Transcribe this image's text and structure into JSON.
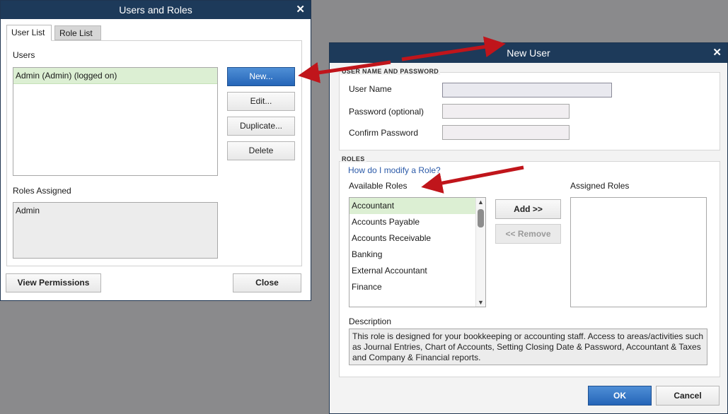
{
  "users_roles": {
    "title": "Users and Roles",
    "tabs": [
      {
        "label": "User List",
        "active": true
      },
      {
        "label": "Role List",
        "active": false
      }
    ],
    "users_label": "Users",
    "users": [
      "Admin (Admin) (logged on)"
    ],
    "buttons": {
      "new": "New...",
      "edit": "Edit...",
      "duplicate": "Duplicate...",
      "delete": "Delete"
    },
    "roles_assigned_label": "Roles Assigned",
    "roles_assigned": [
      "Admin"
    ],
    "view_permissions": "View Permissions",
    "close": "Close"
  },
  "new_user": {
    "title": "New User",
    "section_user": "USER NAME AND PASSWORD",
    "user_name_label": "User Name",
    "password_label": "Password (optional)",
    "confirm_label": "Confirm Password",
    "user_name_value": "",
    "password_value": "",
    "confirm_value": "",
    "section_roles": "ROLES",
    "help_link": "How do I modify a Role?",
    "available_label": "Available Roles",
    "available_roles": [
      "Accountant",
      "Accounts Payable",
      "Accounts Receivable",
      "Banking",
      "External Accountant",
      "Finance"
    ],
    "selected_role": "Accountant",
    "add_button": "Add >>",
    "remove_button": "<< Remove",
    "assigned_label": "Assigned Roles",
    "assigned_roles": [],
    "description_label": "Description",
    "description": "This role is designed for your bookkeeping or accounting staff. Access to areas/activities such as Journal Entries, Chart of Accounts, Setting Closing Date & Password, Accountant & Taxes and Company & Financial reports.",
    "ok": "OK",
    "cancel": "Cancel"
  },
  "colors": {
    "titlebar": "#1d3a5a",
    "selection": "#dcefd3",
    "primary_button": "#2565b8",
    "arrow": "#c0151b",
    "link": "#2b5aa8"
  },
  "icons": [
    "close-icon",
    "scroll-up-icon",
    "scroll-down-icon"
  ]
}
